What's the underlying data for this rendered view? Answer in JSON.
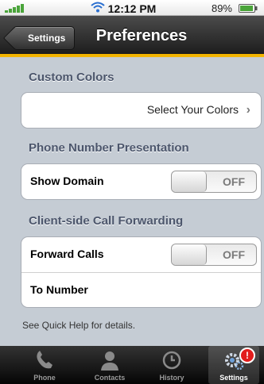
{
  "status_bar": {
    "time": "12:12 PM",
    "battery_percent": "89%"
  },
  "nav": {
    "back_label": "Settings",
    "title": "Preferences"
  },
  "sections": {
    "custom_colors": {
      "header": "Custom Colors",
      "row_value": "Select Your Colors"
    },
    "phone_presentation": {
      "header": "Phone Number Presentation",
      "show_domain_label": "Show Domain",
      "show_domain_state": "OFF"
    },
    "forwarding": {
      "header": "Client-side Call Forwarding",
      "forward_calls_label": "Forward Calls",
      "forward_calls_state": "OFF",
      "to_number_label": "To Number"
    }
  },
  "footer": "See Quick Help for details.",
  "tabs": [
    {
      "label": "Phone",
      "icon": "phone-icon"
    },
    {
      "label": "Contacts",
      "icon": "contacts-icon"
    },
    {
      "label": "History",
      "icon": "clock-icon"
    },
    {
      "label": "Settings",
      "icon": "gear-icon",
      "badge": "!"
    }
  ],
  "colors": {
    "accent": "#f3b400",
    "section_text": "#4c566c",
    "badge": "#e21c1c",
    "signal": "#4aa43a"
  }
}
